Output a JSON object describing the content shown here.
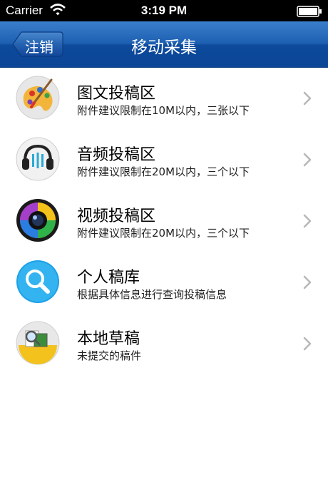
{
  "status_bar": {
    "carrier": "Carrier",
    "time": "3:19 PM"
  },
  "nav": {
    "back_label": "注销",
    "title": "移动采集"
  },
  "menu": [
    {
      "title": "图文投稿区",
      "subtitle": "附件建议限制在10M以内，三张以下",
      "icon": "palette-icon"
    },
    {
      "title": "音频投稿区",
      "subtitle": "附件建议限制在20M以内，三个以下",
      "icon": "headphones-icon"
    },
    {
      "title": "视频投稿区",
      "subtitle": "附件建议限制在20M以内，三个以下",
      "icon": "camera-lens-icon"
    },
    {
      "title": "个人稿库",
      "subtitle": "根据具体信息进行查询投稿信息",
      "icon": "search-icon"
    },
    {
      "title": "本地草稿",
      "subtitle": "未提交的稿件",
      "icon": "draft-box-icon"
    }
  ]
}
